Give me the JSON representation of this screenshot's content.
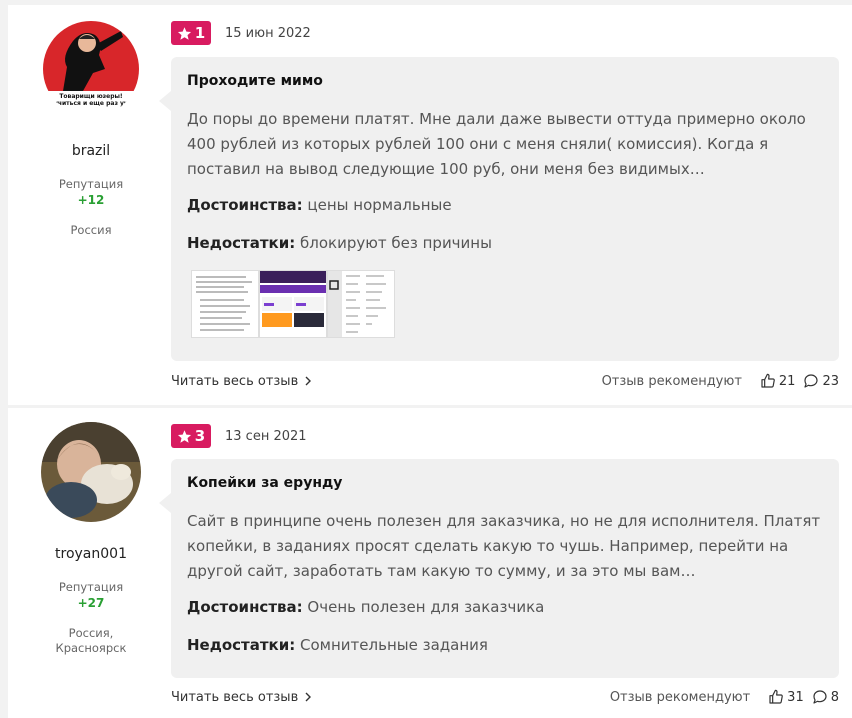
{
  "reviews": [
    {
      "user": {
        "name": "brazil",
        "rep_label": "Репутация",
        "rep_value": "+12",
        "location": "Россия",
        "avatar_caption": "Товарищи юзеры! учиться и еще раз уч"
      },
      "rating": "1",
      "date": "15 июн 2022",
      "title": "Проходите мимо",
      "text": "До поры до времени платят. Мне дали даже вывести оттуда примерно около 400 рублей из которых рублей 100 они с меня сняли( комиссия). Когда я поставил на вывод следующие 100 руб, они меня без видимых…",
      "pros_label": "Достоинства:",
      "pros": "цены нормальные",
      "cons_label": "Недостатки:",
      "cons": "блокируют без причины",
      "read_more": "Читать весь отзыв",
      "recommend_label": "Отзыв рекомендуют",
      "likes": "21",
      "comments": "23"
    },
    {
      "user": {
        "name": "troyan001",
        "rep_label": "Репутация",
        "rep_value": "+27",
        "location": "Россия, Красноярск"
      },
      "rating": "3",
      "date": "13 сен 2021",
      "title": "Копейки за ерунду",
      "text": "Сайт в принципе очень полезен для заказчика, но не для исполнителя. Платят копейки, в заданиях просят сделать какую то чушь. Например, перейти на другой сайт, заработать там какую то сумму, и за это мы вам…",
      "pros_label": "Достоинства:",
      "pros": "Очень полезен для заказчика",
      "cons_label": "Недостатки:",
      "cons": "Сомнительные задания",
      "read_more": "Читать весь отзыв",
      "recommend_label": "Отзыв рекомендуют",
      "likes": "31",
      "comments": "8"
    }
  ],
  "colors": {
    "badge": "#d81b60",
    "reputation": "#2aa034",
    "bubble": "#f0f0f0"
  },
  "icons": [
    "star-icon",
    "chevron-right-icon",
    "thumbs-up-icon",
    "comment-icon"
  ]
}
